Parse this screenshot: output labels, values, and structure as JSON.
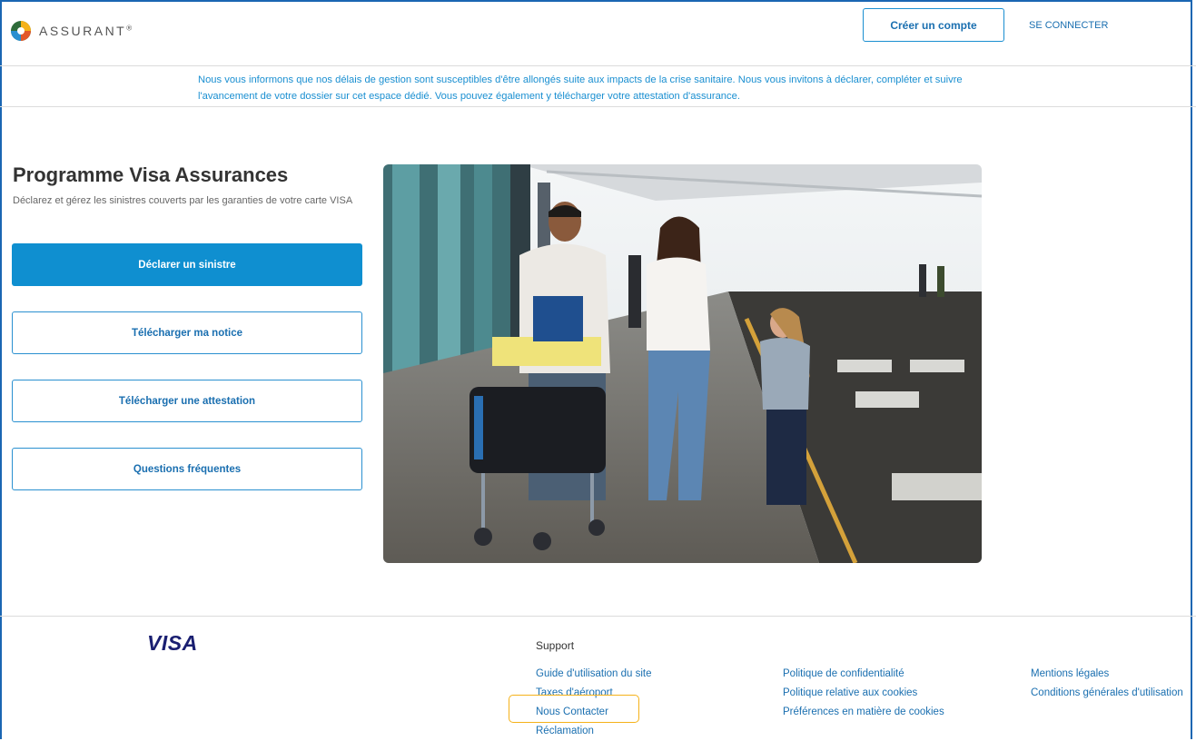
{
  "header": {
    "logo_text": "ASSURANT",
    "logo_trademark": "®",
    "create_account_label": "Créer un compte",
    "login_label": "SE CONNECTER"
  },
  "notice": {
    "line1": "Nous vous informons que nos délais de gestion sont susceptibles d'être allongés suite aux impacts de la crise sanitaire. Nous vous invitons à déclarer, compléter et suivre",
    "line2": "l'avancement de votre dossier sur cet espace dédié. Vous pouvez également y télécharger votre attestation d'assurance."
  },
  "main": {
    "title": "Programme Visa Assurances",
    "subtitle": "Déclarez et gérez les sinistres couverts par les garanties de votre carte VISA",
    "buttons": [
      {
        "label": "Déclarer un sinistre"
      },
      {
        "label": "Télécharger ma notice"
      },
      {
        "label": "Télécharger une attestation"
      },
      {
        "label": "Questions fréquentes"
      }
    ],
    "image_icon": "airport-family-photo"
  },
  "footer": {
    "visa_logo": "VISA",
    "support_heading": "Support",
    "col1": [
      "Guide d'utilisation du site",
      "Taxes d'aéroport",
      "Nous Contacter",
      "Réclamation"
    ],
    "col2": [
      "Politique de confidentialité",
      "Politique relative aux cookies",
      "Préférences en matière de cookies"
    ],
    "col3": [
      "Mentions légales",
      "Conditions générales d'utilisation"
    ]
  },
  "colors": {
    "primary": "#0f8fd0",
    "link": "#1a6fb0",
    "notice_text": "#1a8fd1",
    "highlight": "#f5b21a",
    "visa": "#1a1f71"
  }
}
